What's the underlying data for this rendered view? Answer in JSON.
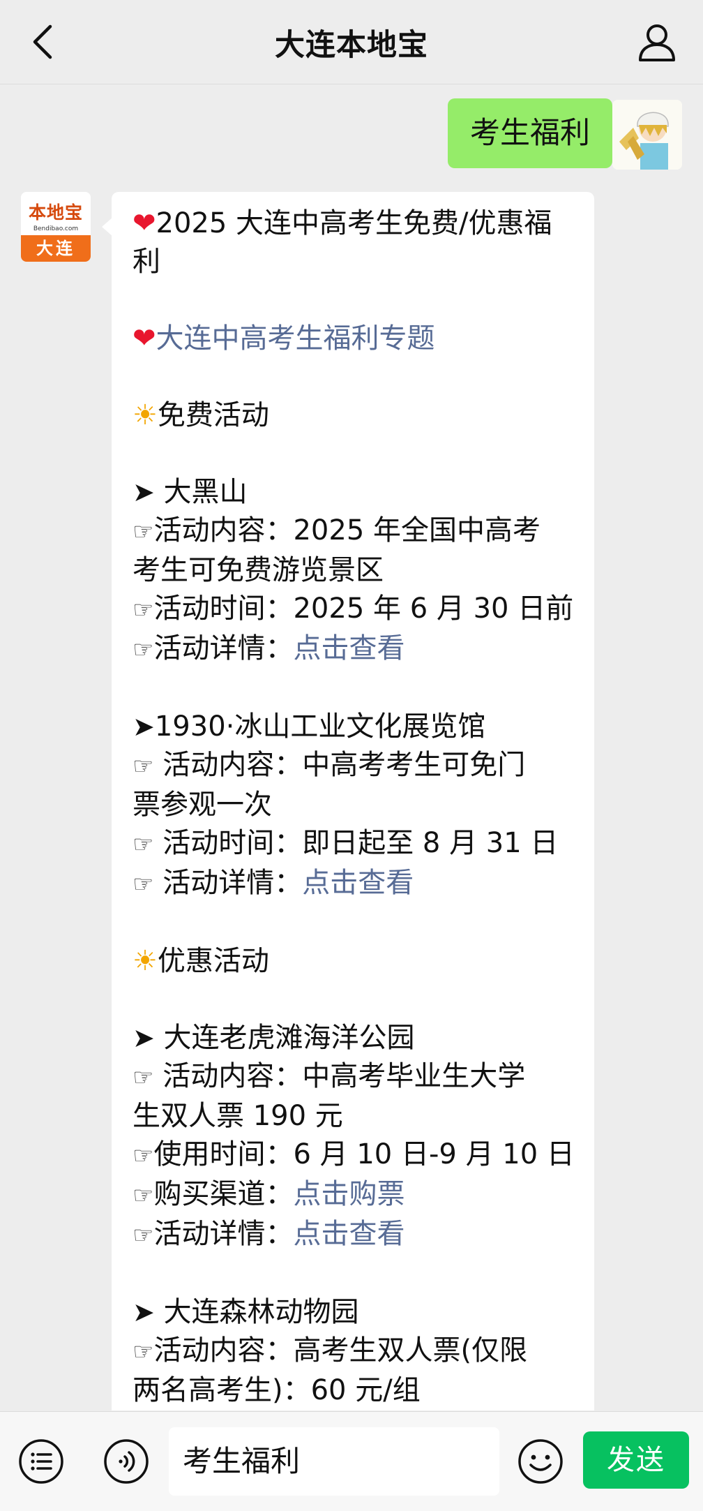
{
  "header": {
    "title": "大连本地宝",
    "back_icon": "back-arrow-icon",
    "profile_icon": "person-icon"
  },
  "user_message": {
    "text": "考生福利"
  },
  "bot_avatar": {
    "logo_text": "本地宝",
    "logo_sub": "Bendibao.com",
    "city": "大连"
  },
  "bot_message": {
    "title_line1": "2025 大连中高考生免费/优惠福",
    "title_line2": "利",
    "topic_link": "大连中高考生福利专题",
    "section_free": "免费活动",
    "item1": {
      "name": " 大黑山",
      "content_line1": "活动内容：2025 年全国中高考",
      "content_line2": "考生可免费游览景区",
      "time": "活动时间：2025 年 6 月 30 日前",
      "detail_label": "活动详情：",
      "detail_link": "点击查看"
    },
    "item2": {
      "name": "1930·冰山工业文化展览馆",
      "content_line1": " 活动内容：中高考考生可免门",
      "content_line2": "票参观一次",
      "time": " 活动时间：即日起至 8 月 31 日",
      "detail_label": " 活动详情：",
      "detail_link": "点击查看"
    },
    "section_discount": "优惠活动",
    "item3": {
      "name": " 大连老虎滩海洋公园",
      "content_line1": " 活动内容：中高考毕业生大学",
      "content_line2": "生双人票 190 元",
      "time": "使用时间：6 月 10 日-9 月 10 日",
      "buy_label": "购买渠道：",
      "buy_link": "点击购票",
      "detail_label": "活动详情：",
      "detail_link": "点击查看"
    },
    "item4": {
      "name": " 大连森林动物园",
      "content_line1": "活动内容：高考生双人票(仅限",
      "content_line2": "两名高考生)：60 元/组"
    }
  },
  "bottom_bar": {
    "menu_icon": "list-menu-icon",
    "voice_icon": "voice-icon",
    "input_value": "考生福利",
    "emoji_icon": "smiley-icon",
    "send_label": "发送"
  },
  "colors": {
    "background": "#ededed",
    "user_bubble": "#95ec69",
    "link": "#576b95",
    "send_button": "#07c160",
    "brand_orange": "#f06e1a"
  }
}
